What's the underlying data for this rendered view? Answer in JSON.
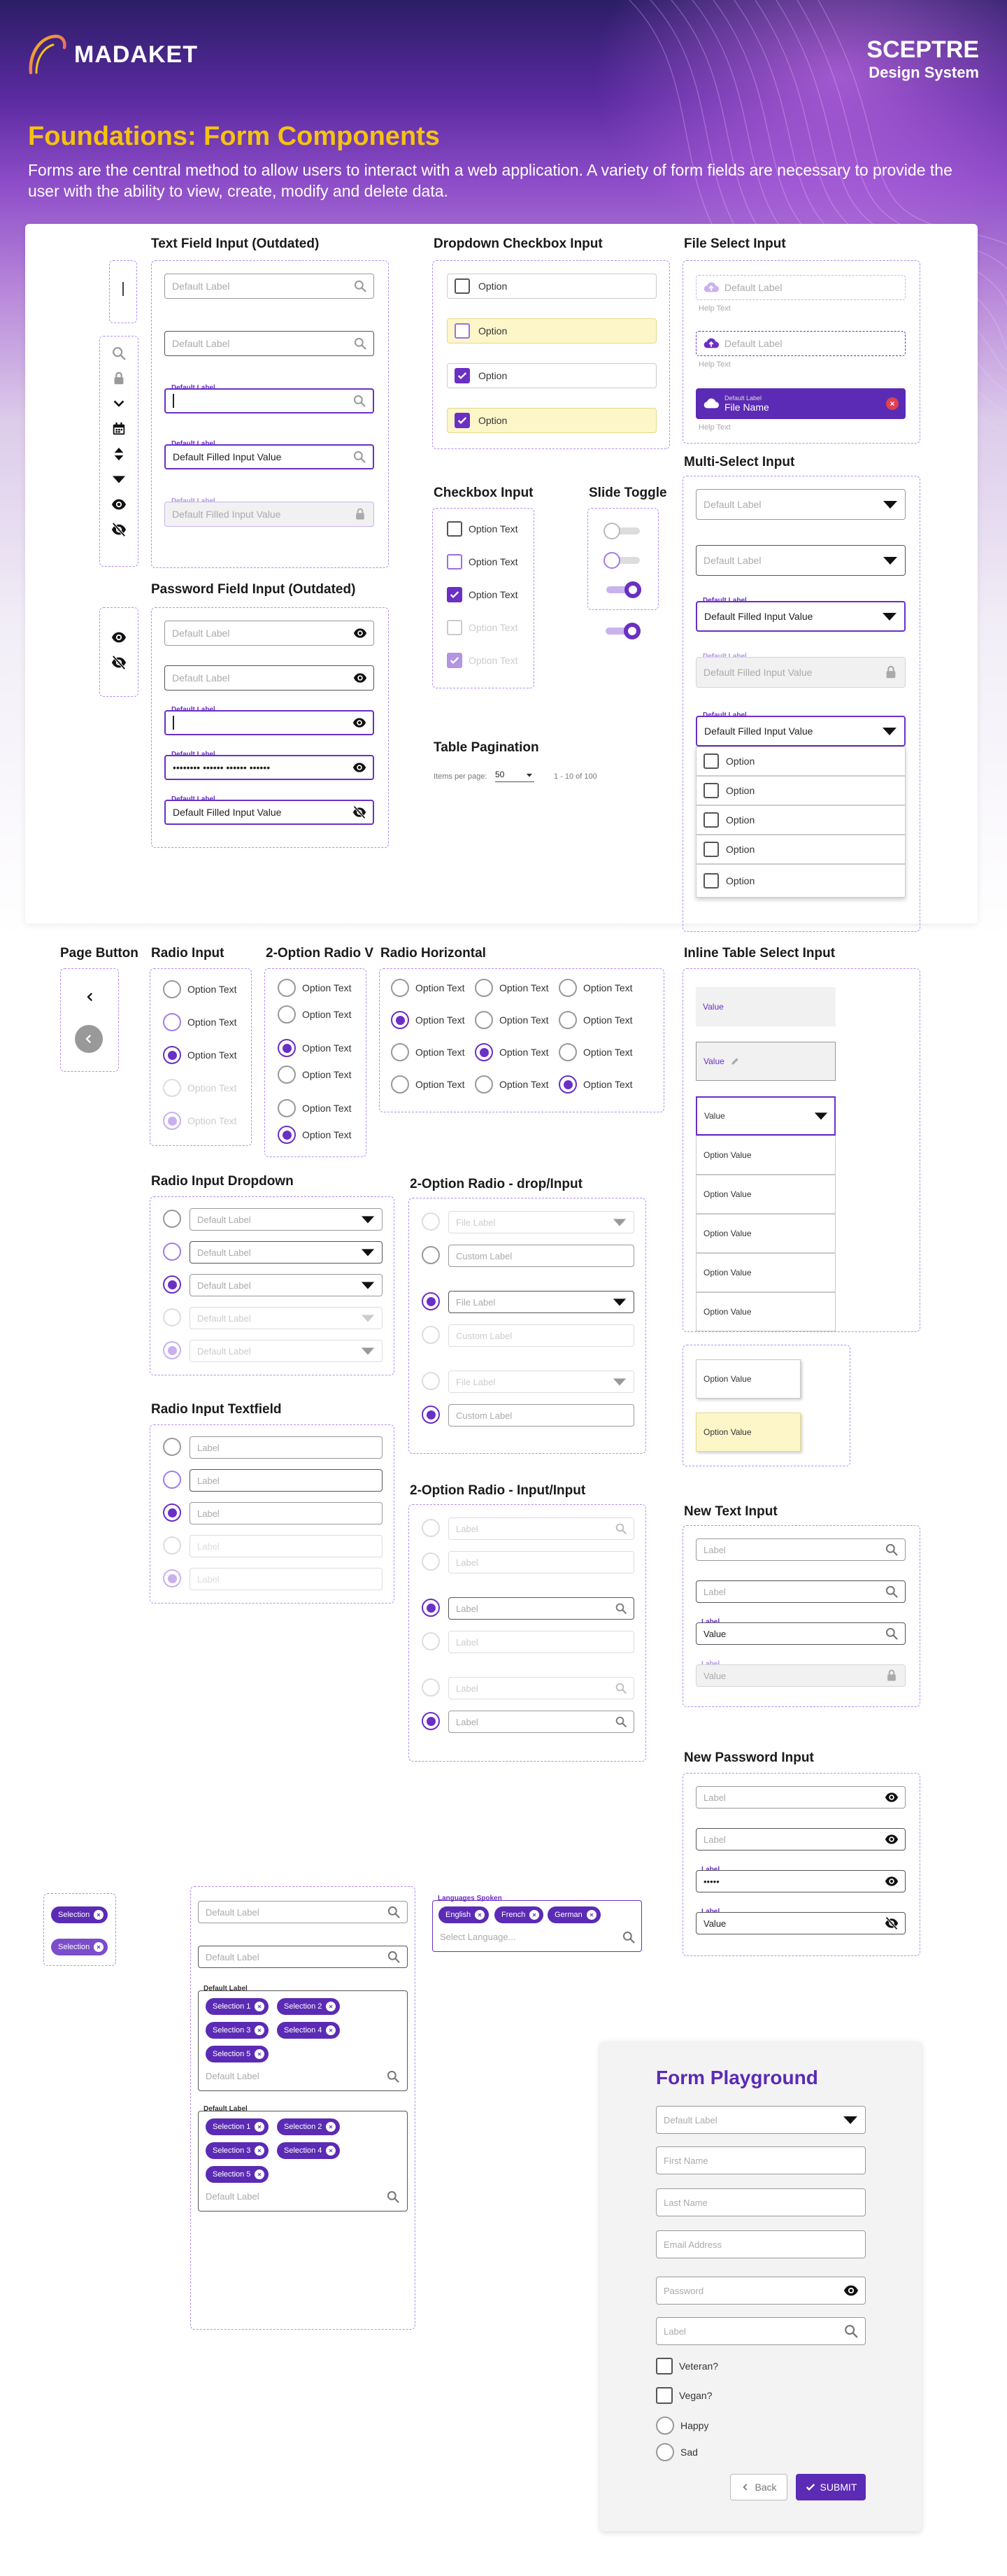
{
  "header": {
    "logo_text": "MADAKET",
    "brand_name": "SCEPTRE",
    "brand_subtitle": "Design System"
  },
  "page": {
    "title": "Foundations: Form Components",
    "description": "Forms are the central method to allow users to interact with a web application. A variety of form fields are necessary to provide the user with the ability to view, create, modify and delete data."
  },
  "icons": [
    "search-icon",
    "lock-icon",
    "chevron-down-icon",
    "calendar-icon",
    "sort-icon",
    "dropdown-arrow-icon",
    "eye-icon",
    "eye-off-icon",
    "cloud-upload-icon",
    "pencil-icon",
    "chevron-left-icon",
    "check-icon",
    "close-icon"
  ],
  "colors": {
    "primary": "#6b2fc4",
    "title_yellow": "#f5c211",
    "selected_fill": "#fdf6c9",
    "focus_border": "#6b2fc4"
  },
  "sections": {
    "text_field": "Text Field Input (Outdated)",
    "password_field": "Password Field Input (Outdated)",
    "dropdown_checkbox": "Dropdown Checkbox Input",
    "checkbox": "Checkbox Input",
    "slide_toggle": "Slide Toggle",
    "table_pagination": "Table Pagination",
    "file_select": "File Select Input",
    "multi_select": "Multi-Select Input",
    "page_button": "Page Button",
    "radio": "Radio Input",
    "radio_2opt_v": "2-Option Radio V",
    "radio_horizontal": "Radio Horizontal",
    "inline_table_select": "Inline Table Select Input",
    "radio_dropdown": "Radio Input Dropdown",
    "radio_2opt_drop": "2-Option Radio  - drop/Input",
    "radio_textfield": "Radio Input Textfield",
    "radio_2opt_input": "2-Option Radio  - Input/Input",
    "new_text": "New Text Input",
    "new_password": "New Password Input"
  },
  "labels": {
    "default_label": "Default Label",
    "filled_value": "Default Filled Input Value",
    "password_mask": "•••••••• •••••• •••••• ••••••",
    "option": "Option",
    "option_text": "Option Text",
    "help_text": "Help Text",
    "file_name": "File Name",
    "file_label": "File Label",
    "custom_label": "Custom Label",
    "label": "Label",
    "value": "Value",
    "option_value": "Option Value",
    "password_short": "•••••",
    "selection": "Selection",
    "languages_label": "Languages Spoken",
    "select_language": "Select Language...",
    "lang_english": "English",
    "lang_french": "French",
    "lang_german": "German",
    "sel1": "Selection 1",
    "sel2": "Selection 2",
    "sel3": "Selection 3",
    "sel4": "Selection 4",
    "sel5": "Selection 5",
    "chip_close": "x"
  },
  "pagination": {
    "items_per_page_label": "Items per page:",
    "page_size": "50",
    "range": "1 - 10 of 100"
  },
  "playground": {
    "title": "Form Playground",
    "dropdown_placeholder": "Default Label",
    "first_name": "First Name",
    "last_name": "Last Name",
    "email": "Email Address",
    "password": "Password",
    "search_label": "Label",
    "checkbox_1": "Veteran?",
    "checkbox_2": "Vegan?",
    "radio_1": "Happy",
    "radio_2": "Sad",
    "back_label": "Back",
    "submit_label": "SUBMIT"
  }
}
